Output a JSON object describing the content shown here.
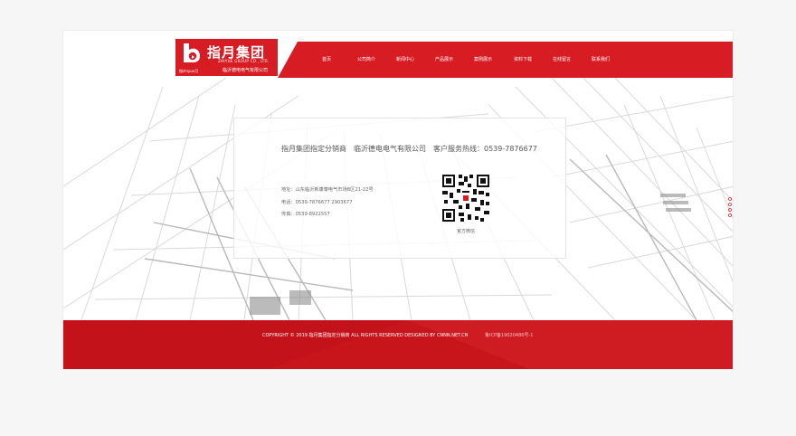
{
  "brand": {
    "name": "指月集团",
    "english": "ZHIYUE GROUP CO., LTD.",
    "company": "临沂德电电气有限公司",
    "small_tag": "指zhiyue月"
  },
  "nav": {
    "items": [
      "首页",
      "公司简介",
      "新闻中心",
      "产品展示",
      "案例展示",
      "资料下载",
      "在线留言",
      "联系我们"
    ]
  },
  "contact": {
    "headline": "指月集团指定分销商　临沂德电电气有限公司　客户服务热线：0539-7876677",
    "address": "地址：山东临沂新康泰电气市场B区21-22号",
    "phone": "电话：0539-7876677 2903677",
    "fax": "传真：0539-8922557",
    "qr_label": "官方微信"
  },
  "footer": {
    "copyright": "COPYRIGHT © 2019 指月集团指定分销商 ALL RIGHTS RESERVED DESIGNED BY CNNN.NET.CN",
    "icp": "鲁ICP备19020486号-1"
  },
  "colors": {
    "brand_red": "#d71d23",
    "footer_red": "#c8141b"
  },
  "icons": {
    "logo": "b-letter-logo-icon",
    "qr": "qr-code-icon"
  }
}
